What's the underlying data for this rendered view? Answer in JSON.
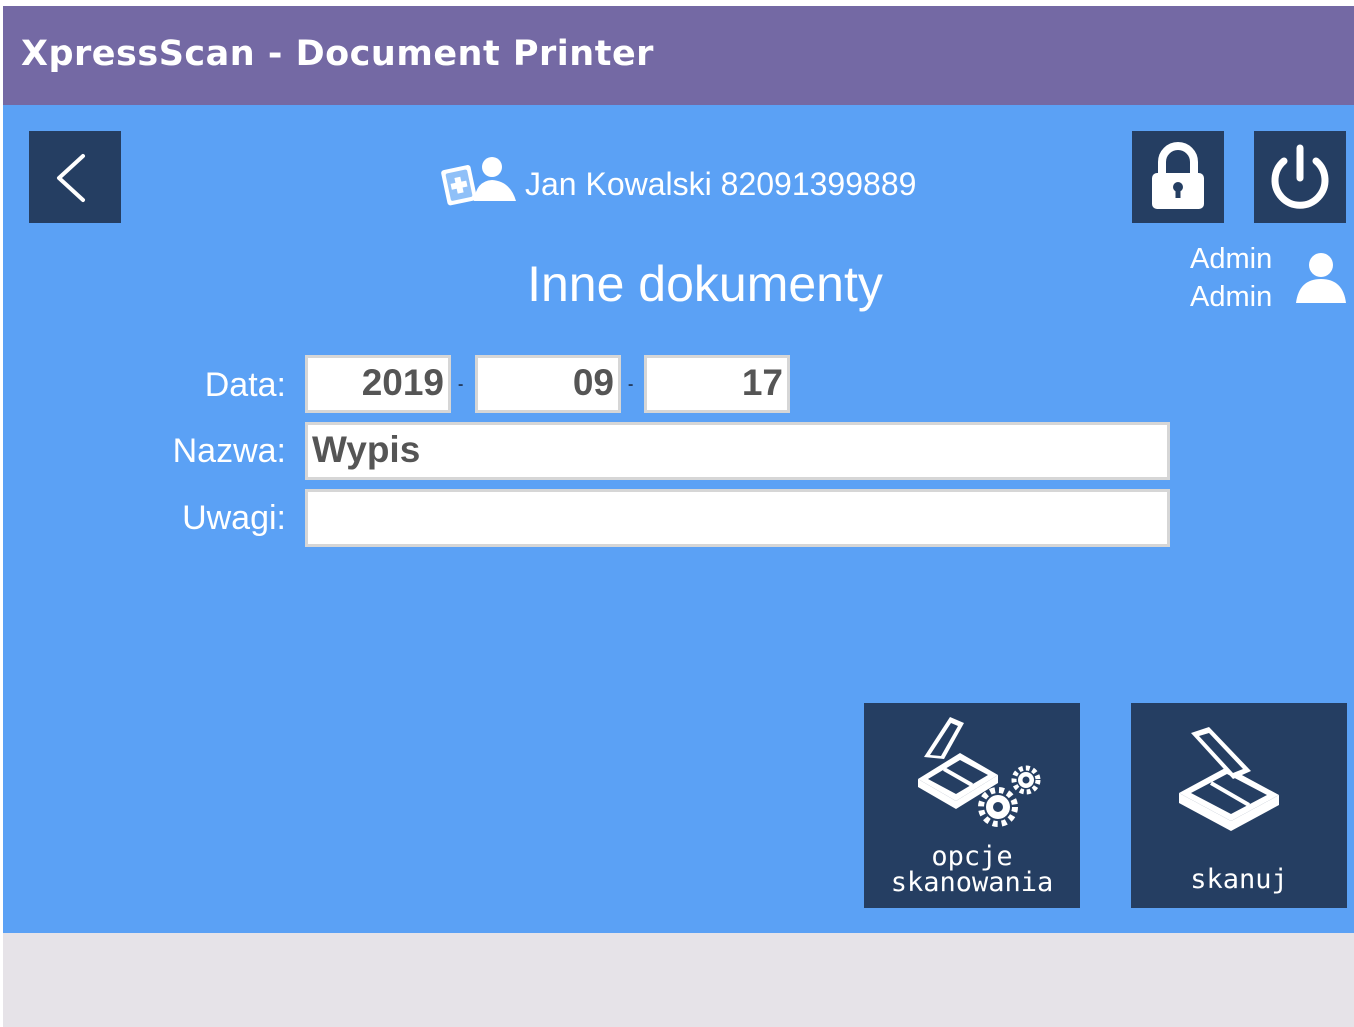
{
  "window": {
    "title": "XpressScan - Document Printer"
  },
  "patient": {
    "name": "Jan Kowalski 82091399889"
  },
  "user": {
    "first": "Admin",
    "last": "Admin"
  },
  "heading": "Inne dokumenty",
  "form": {
    "date_label": "Data:",
    "year": "2019",
    "month": "09",
    "day": "17",
    "separator": "-",
    "name_label": "Nazwa:",
    "name_value": "Wypis",
    "notes_label": "Uwagi:",
    "notes_value": ""
  },
  "actions": {
    "scan_options_line1": "opcje",
    "scan_options_line2": "skanowania",
    "scan": "skanuj"
  },
  "colors": {
    "titlebar": "#7469a4",
    "background": "#5ba1f5",
    "tile": "#253e62",
    "footer": "#e6e3e8"
  },
  "icons": {
    "back": "chevron-left-icon",
    "patient": "patient-card-icon",
    "lock": "lock-icon",
    "power": "power-icon",
    "user": "user-icon",
    "scan_options": "scanner-gear-icon",
    "scan": "scanner-icon"
  }
}
